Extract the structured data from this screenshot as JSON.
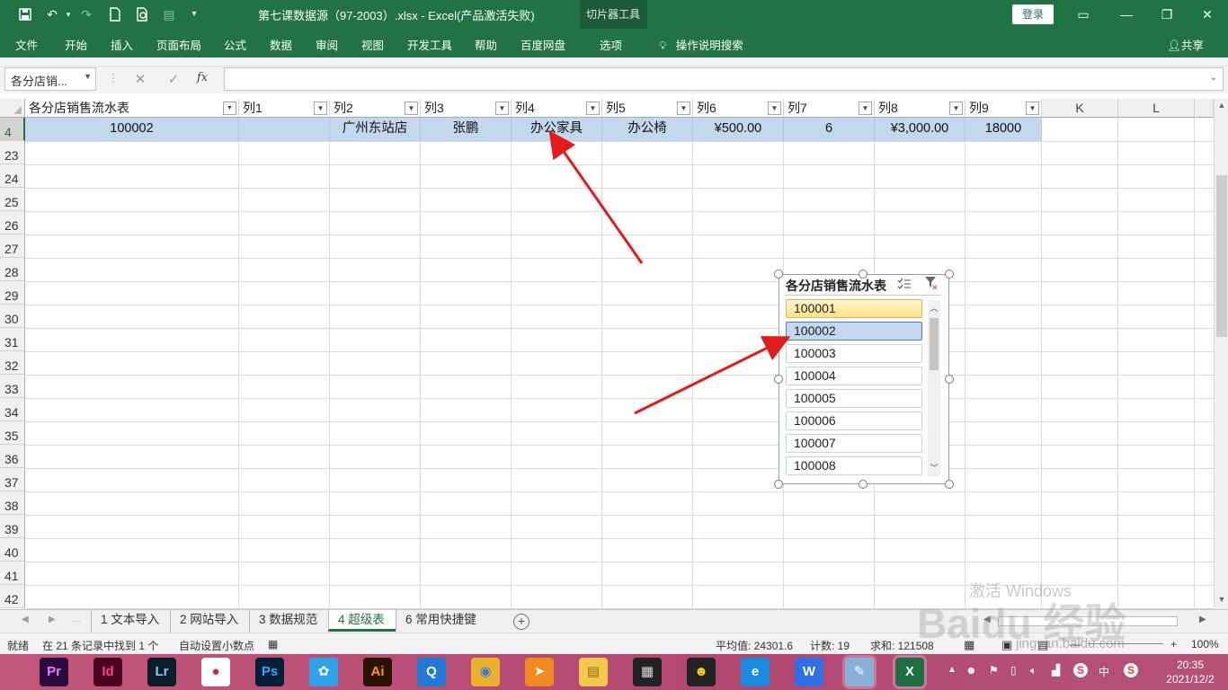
{
  "titlebar": {
    "title": "第七课数据源（97-2003）.xlsx  -  Excel(产品激活失败)",
    "context_tab_group": "切片器工具",
    "login": "登录",
    "quick_access_customize": "▾"
  },
  "ribbon": {
    "tabs": [
      "文件",
      "开始",
      "插入",
      "页面布局",
      "公式",
      "数据",
      "审阅",
      "视图",
      "开发工具",
      "帮助",
      "百度网盘",
      "选项"
    ],
    "tell_me": "操作说明搜索",
    "share": "共享"
  },
  "formula_bar": {
    "name_box": "各分店销...",
    "fx": "fx",
    "formula": ""
  },
  "columns": [
    {
      "label": "各分店销售流水表",
      "filter": "filtered"
    },
    {
      "label": "列1",
      "filter": "dropdown"
    },
    {
      "label": "列2",
      "filter": "dropdown"
    },
    {
      "label": "列3",
      "filter": "dropdown"
    },
    {
      "label": "列4",
      "filter": "dropdown"
    },
    {
      "label": "列5",
      "filter": "dropdown"
    },
    {
      "label": "列6",
      "filter": "dropdown"
    },
    {
      "label": "列7",
      "filter": "dropdown"
    },
    {
      "label": "列8",
      "filter": "dropdown"
    },
    {
      "label": "列9",
      "filter": "dropdown"
    },
    {
      "label": "K",
      "filter": "none"
    },
    {
      "label": "L",
      "filter": "none"
    }
  ],
  "row_numbers": [
    "4",
    "23",
    "24",
    "25",
    "26",
    "27",
    "28",
    "29",
    "30",
    "31",
    "32",
    "33",
    "34",
    "35",
    "36",
    "37",
    "38",
    "39",
    "40",
    "41",
    "42"
  ],
  "data_row": [
    "100002",
    "",
    "广州东站店",
    "张鹏",
    "办公家具",
    "办公椅",
    "¥500.00",
    "6",
    "¥3,000.00",
    "18000"
  ],
  "slicer": {
    "title": "各分店销售流水表",
    "items": [
      "100001",
      "100002",
      "100003",
      "100004",
      "100005",
      "100006",
      "100007",
      "100008"
    ],
    "selected": "100002",
    "hovered": "100001"
  },
  "sheet_tabs": [
    "1 文本导入",
    "2 网站导入",
    "3 数据规范",
    "4 超级表",
    "6 常用快捷键"
  ],
  "active_sheet": "4 超级表",
  "status": {
    "ready": "就绪",
    "filter_result": "在 21 条记录中找到 1 个",
    "auto_decimal": "自动设置小数点",
    "average": "平均值: 24301.6",
    "count": "计数: 19",
    "sum": "求和: 121508",
    "zoom": "100%"
  },
  "taskbar": {
    "apps": [
      {
        "icon": "premiere-icon",
        "text": "Pr",
        "color": "#2a0a3c",
        "fg": "#e77bff"
      },
      {
        "icon": "indesign-icon",
        "text": "Id",
        "color": "#49021f",
        "fg": "#ff3f94"
      },
      {
        "icon": "lightroom-icon",
        "text": "Lr",
        "color": "#0a1c2a",
        "fg": "#8dc6f0"
      },
      {
        "icon": "record-app-icon",
        "text": "●",
        "color": "#fff",
        "fg": "#d23"
      },
      {
        "icon": "photoshop-icon",
        "text": "Ps",
        "color": "#061e36",
        "fg": "#31a8ff"
      },
      {
        "icon": "chat-bird-icon",
        "text": "✿",
        "color": "#2fa3e8",
        "fg": "#fff"
      },
      {
        "icon": "illustrator-icon",
        "text": "Ai",
        "color": "#2b1200",
        "fg": "#ff9a00"
      },
      {
        "icon": "browser-q-icon",
        "text": "Q",
        "color": "#1f7ad8",
        "fg": "#fff"
      },
      {
        "icon": "chrome-icon",
        "text": "◉",
        "color": "#e9b12e",
        "fg": "#2a7fd8"
      },
      {
        "icon": "player-icon",
        "text": "➤",
        "color": "#f08a1e",
        "fg": "#fff"
      },
      {
        "icon": "file-explorer-icon",
        "text": "▤",
        "color": "#f4c84a",
        "fg": "#8a6a10"
      },
      {
        "icon": "video-editor-icon",
        "text": "▦",
        "color": "#222",
        "fg": "#ddd"
      },
      {
        "icon": "qq-icon",
        "text": "☻",
        "color": "#222",
        "fg": "#ffd21e"
      },
      {
        "icon": "ie-icon",
        "text": "e",
        "color": "#1b8be0",
        "fg": "#fff"
      },
      {
        "icon": "wps-icon",
        "text": "W",
        "color": "#2f6fe3",
        "fg": "#fff"
      },
      {
        "icon": "notes-icon",
        "text": "✎",
        "color": "#8bb0d8",
        "fg": "#fff"
      },
      {
        "icon": "excel-icon",
        "text": "X",
        "color": "#1d6f42",
        "fg": "#fff"
      }
    ],
    "time": "20:35",
    "date": "2021/12/2",
    "ime": "中"
  },
  "watermark": {
    "activate": "激活 Windows",
    "brand": "Baidu 经验",
    "url": "jingyan.baidu.com"
  }
}
